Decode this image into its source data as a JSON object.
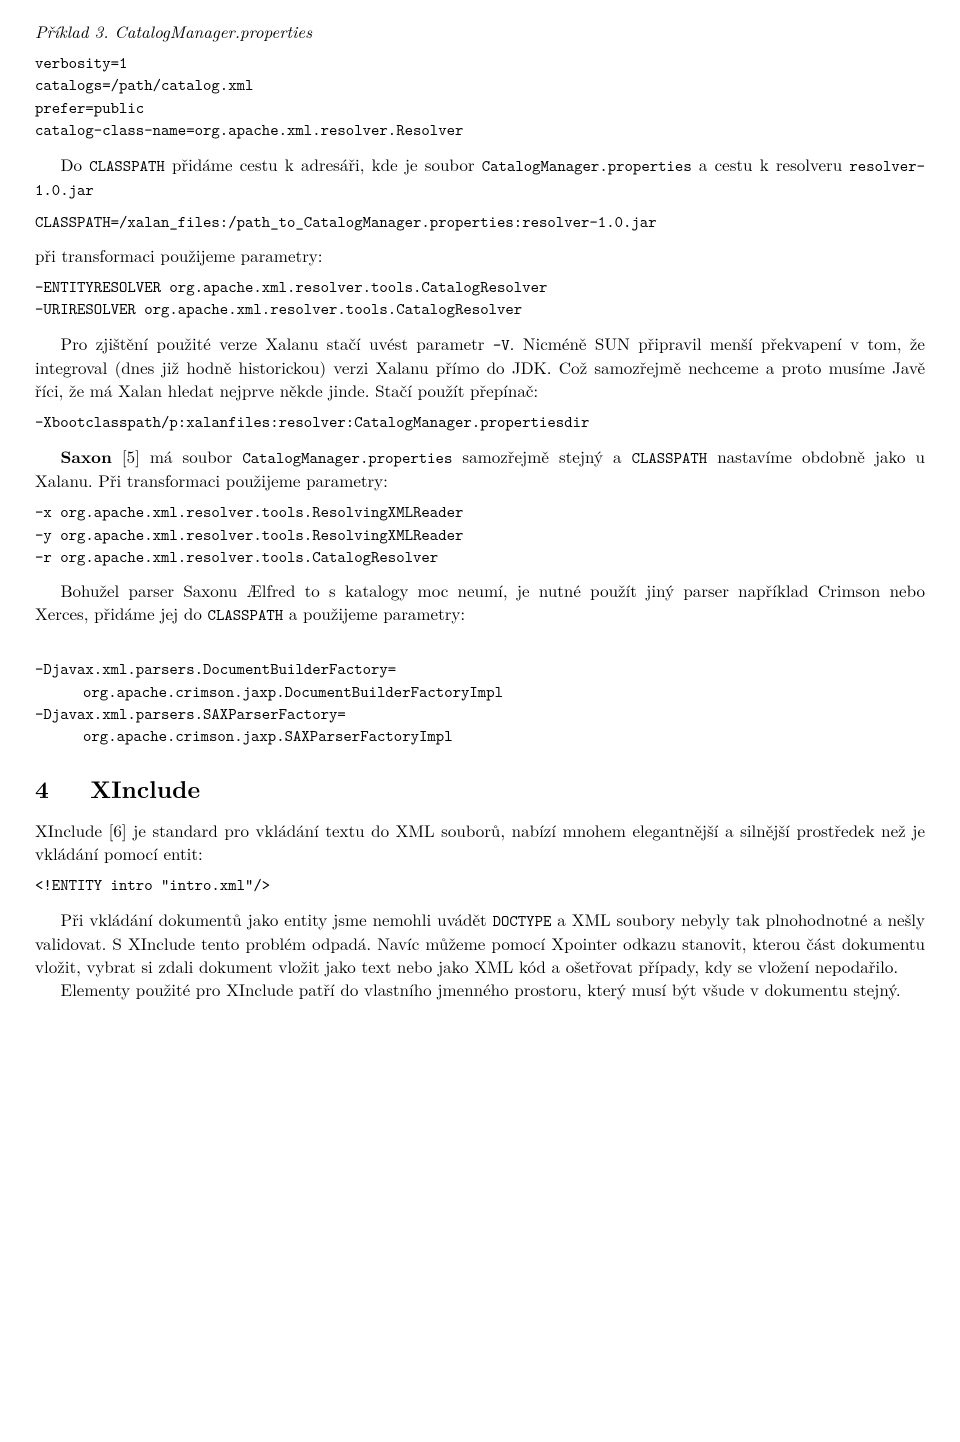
{
  "example_caption": "Příklad 3. CatalogManager.properties",
  "code1": "verbosity=1\ncatalogs=/path/catalog.xml\nprefer=public\ncatalog-class-name=org.apache.xml.resolver.Resolver",
  "para1_a": "Do ",
  "para1_b": "CLASSPATH",
  "para1_c": " přidáme cestu k adresáři, kde je soubor ",
  "para1_d": "CatalogManager.properties",
  "para1_e": " a cestu k resolveru ",
  "para1_f": "resolver-1.0.jar",
  "code2": "CLASSPATH=/xalan_files:/path_to_CatalogManager.properties:resolver-1.0.jar",
  "para2": "při transformaci použijeme parametry:",
  "code3": "-ENTITYRESOLVER org.apache.xml.resolver.tools.CatalogResolver\n-URIRESOLVER org.apache.xml.resolver.tools.CatalogResolver",
  "para3_a": "Pro zjištění použité verze Xalanu stačí uvést parametr ",
  "para3_b": "-V",
  "para3_c": ". Nicméně SUN připravil menší překvapení v tom, že integroval (dnes již hodně historickou) verzi Xalanu přímo do JDK. Což samozřejmě nechceme a proto musíme Javě říci, že má Xalan hledat nejprve někde jinde. Stačí použít přepínač:",
  "code4": "-Xbootclasspath/p:xalanfiles:resolver:CatalogManager.propertiesdir",
  "para4_a": "Saxon",
  "para4_b": " [5] má soubor ",
  "para4_c": "CatalogManager.properties",
  "para4_d": " samozřejmě stejný a ",
  "para4_e": "CLASSPATH",
  "para4_f": " nastavíme obdobně jako u Xalanu. Při transformaci použijeme parametry:",
  "code5": "-x org.apache.xml.resolver.tools.ResolvingXMLReader\n-y org.apache.xml.resolver.tools.ResolvingXMLReader\n-r org.apache.xml.resolver.tools.CatalogResolver",
  "para5_a": "Bohužel parser Saxonu Ælfred to s katalogy moc neumí, je nutné použít jiný parser například Crimson nebo Xerces, přidáme jej do ",
  "para5_b": "CLASSPATH",
  "para5_c": " a použijeme parametry:",
  "code6_l1": "-Djavax.xml.parsers.DocumentBuilderFactory=",
  "code6_l2": "org.apache.crimson.jaxp.DocumentBuilderFactoryImpl",
  "code6_l3": "-Djavax.xml.parsers.SAXParserFactory=",
  "code6_l4": "org.apache.crimson.jaxp.SAXParserFactoryImpl",
  "section_num": "4",
  "section_title": "XInclude",
  "para6": "XInclude [6] je standard pro vkládání textu do XML souborů, nabízí mnohem elegantnější a silnější prostředek než je vkládání pomocí entit:",
  "code7": "<!ENTITY intro \"intro.xml\"/>",
  "para7_a": "Při vkládání dokumentů jako entity jsme nemohli uvádět ",
  "para7_b": "DOCTYPE",
  "para7_c": " a XML soubory nebyly tak plnohodnotné a nešly validovat. S XInclude tento problém odpadá. Navíc můžeme pomocí Xpointer odkazu stanovit, kterou část dokumentu vložit, vybrat si zdali dokument vložit jako text nebo jako XML kód a ošetřovat případy, kdy se vložení nepodařilo.",
  "para8": "Elementy použité pro XInclude patří do vlastního jmenného prostoru, který musí být všude v dokumentu stejný."
}
